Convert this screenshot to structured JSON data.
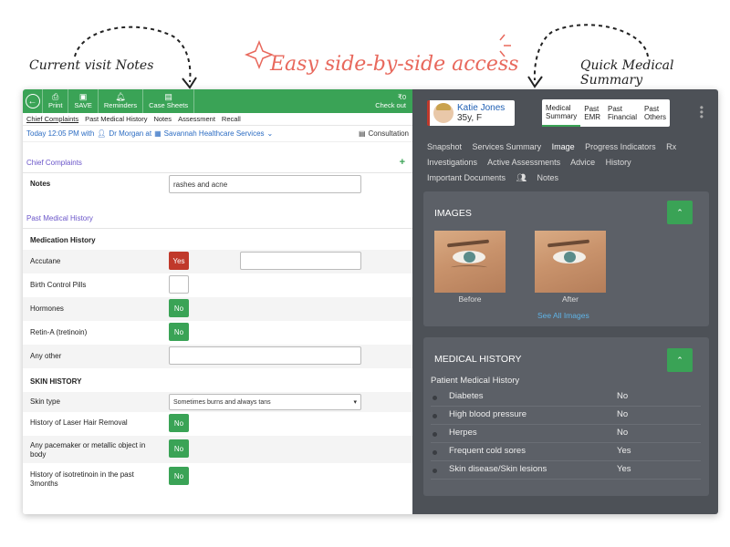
{
  "annotations": {
    "left_label": "Current visit Notes",
    "headline": "Easy side-by-side access",
    "right_label": "Quick Medical Summary"
  },
  "toolbar": {
    "print": "Print",
    "save": "SAVE",
    "reminders": "Reminders",
    "case_sheets": "Case Sheets",
    "checkout_amount": "₹0",
    "checkout": "Check out"
  },
  "subnav": [
    "Chief Complaints",
    "Past Medical History",
    "Notes",
    "Assessment",
    "Recall"
  ],
  "visit": {
    "time": "Today 12:05 PM with",
    "doctor": "Dr Morgan at",
    "clinic": "Savannah Healthcare Services",
    "consultation": "Consultation"
  },
  "chief_complaints": {
    "title": "Chief Complaints",
    "notes_label": "Notes",
    "notes_value": "rashes and acne"
  },
  "past_medical_history": {
    "title": "Past Medical History",
    "medication_history_label": "Medication History",
    "medications": [
      {
        "label": "Accutane",
        "answer": "Yes"
      },
      {
        "label": "Birth Control Pills",
        "answer": ""
      },
      {
        "label": "Hormones",
        "answer": "No"
      },
      {
        "label": "Retin-A (tretinoin)",
        "answer": "No"
      },
      {
        "label": "Any other",
        "answer": ""
      }
    ],
    "skin_history_label": "SKIN HISTORY",
    "skin_type_label": "Skin type",
    "skin_type_value": "Sometimes burns and always tans",
    "skin_items": [
      {
        "label": "History of Laser Hair Removal",
        "answer": "No"
      },
      {
        "label_line1": "Any pacemaker or metallic object in",
        "label_line2": "body",
        "answer": "No"
      },
      {
        "label_line1": "History of isotretinoin in the past",
        "label_line2": "3months",
        "answer": "No"
      }
    ]
  },
  "patient": {
    "name": "Katie Jones",
    "age_sex": "35y, F"
  },
  "right_tabs": [
    {
      "line1": "Medical",
      "line2": "Summary"
    },
    {
      "line1": "Past",
      "line2": "EMR"
    },
    {
      "line1": "Past",
      "line2": "Financial"
    },
    {
      "line1": "Past",
      "line2": "Others"
    }
  ],
  "right_nav": [
    "Snapshot",
    "Services Summary",
    "Image",
    "Progress Indicators",
    "Rx",
    "Investigations",
    "Active Assessments",
    "Advice",
    "History",
    "Important Documents",
    "Notes"
  ],
  "images_card": {
    "title": "IMAGES",
    "before": "Before",
    "after": "After",
    "see_all": "See All Images"
  },
  "medical_history_card": {
    "title": "MEDICAL HISTORY",
    "subtitle": "Patient Medical History",
    "rows": [
      {
        "name": "Diabetes",
        "value": "No"
      },
      {
        "name": "High blood pressure",
        "value": "No"
      },
      {
        "name": "Herpes",
        "value": "No"
      },
      {
        "name": "Frequent cold sores",
        "value": "Yes"
      },
      {
        "name": "Skin disease/Skin lesions",
        "value": "Yes"
      }
    ]
  },
  "colors": {
    "green": "#3aa356",
    "red": "#c0392b",
    "dark_panel": "#4d5157",
    "headline": "#e8685c"
  }
}
